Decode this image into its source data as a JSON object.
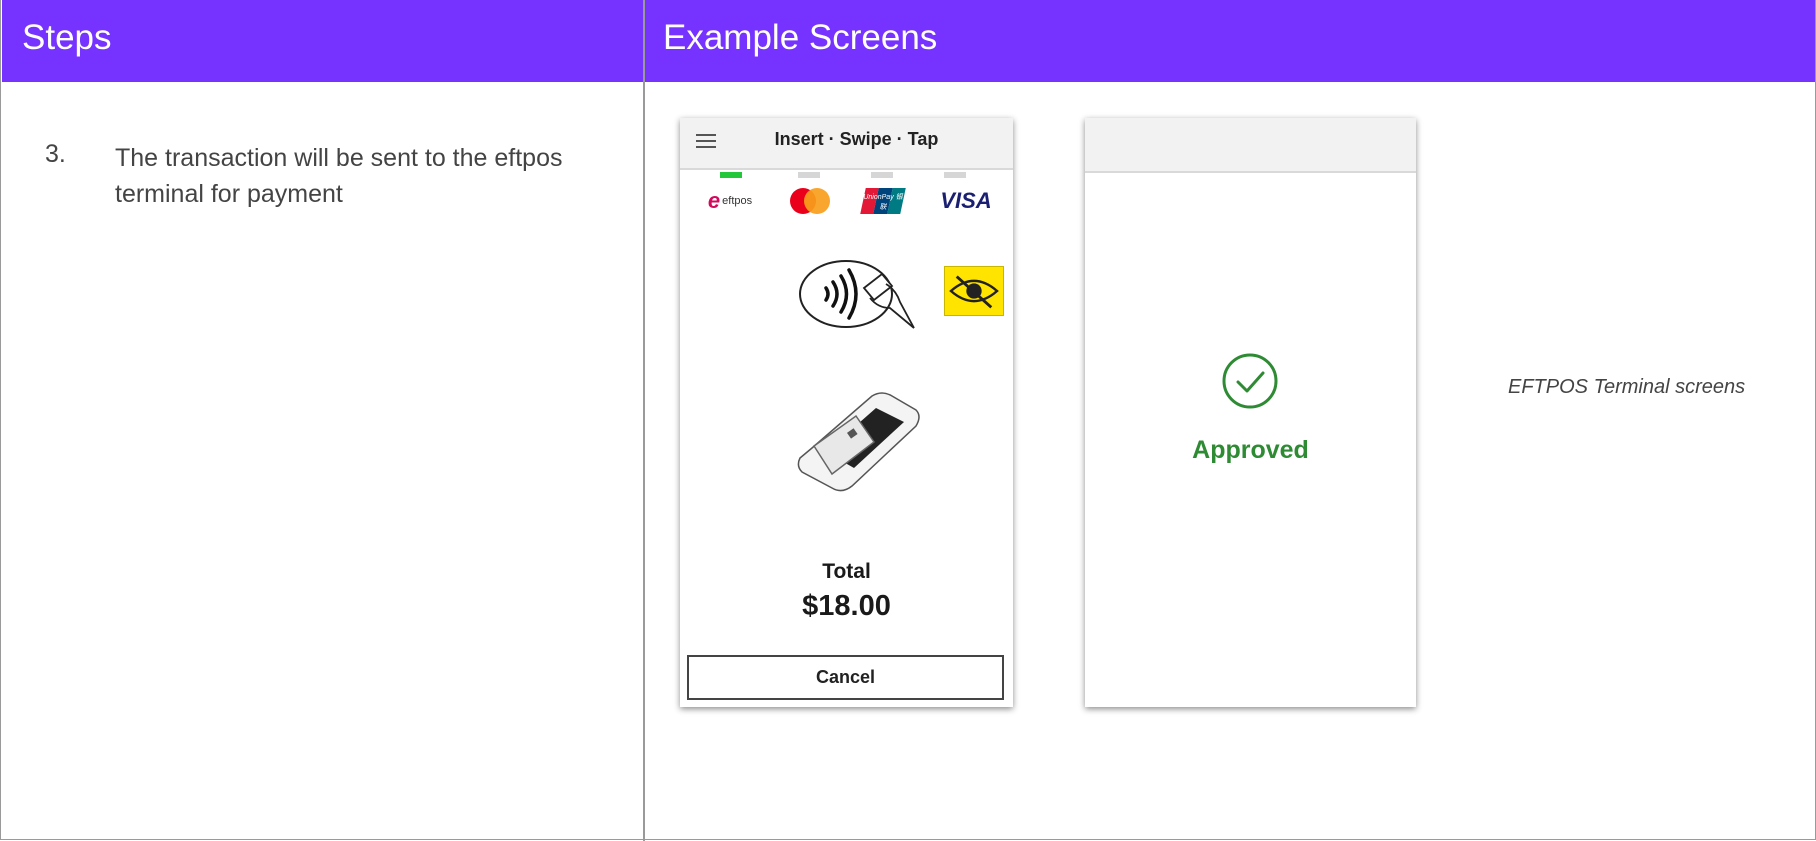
{
  "header": {
    "steps_title": "Steps",
    "examples_title": "Example Screens"
  },
  "step": {
    "number": "3.",
    "text": "The transaction will be sent to the eftpos terminal for payment"
  },
  "payment_screen": {
    "title": "Insert · Swipe · Tap",
    "card_brands": [
      "eftpos",
      "Mastercard",
      "UnionPay 银联",
      "VISA"
    ],
    "brand_labels": {
      "eftpos": "eftpos",
      "unionpay": "UnionPay 银联",
      "visa": "VISA"
    },
    "active_indicator": 0,
    "total_label": "Total",
    "total_amount": "$18.00",
    "cancel_label": "Cancel",
    "icons": [
      "menu-icon",
      "contactless-icon",
      "no-see-icon",
      "card-terminal-icon"
    ]
  },
  "approved_screen": {
    "status": "Approved",
    "icons": [
      "check-circle-icon"
    ]
  },
  "caption": "EFTPOS Terminal screens",
  "colors": {
    "header_bg": "#7632ff",
    "header_text": "#ffffff",
    "approved_green": "#2e8b34",
    "active_indicator": "#22c83a",
    "inactive_indicator": "#d6d6d6",
    "eftpos_red": "#d20a5c",
    "mastercard_red": "#eb001b",
    "mastercard_orange": "#f79e1b",
    "visa_blue": "#1a1f71",
    "unionpay_red": "#e21836",
    "unionpay_blue": "#00447c",
    "unionpay_teal": "#007b84",
    "no_see_yellow": "#ffe400"
  }
}
